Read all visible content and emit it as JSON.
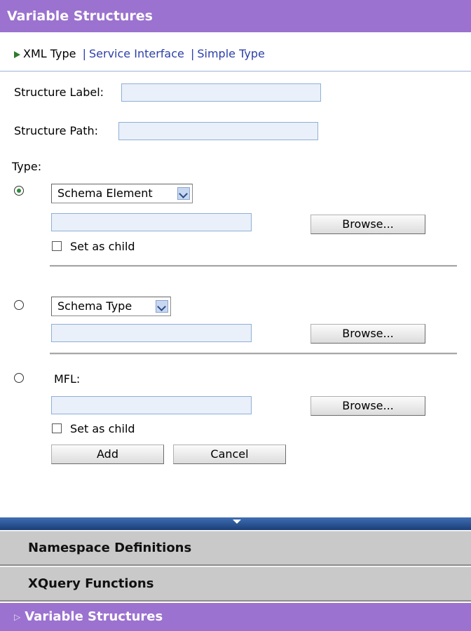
{
  "header": {
    "title": "Variable Structures"
  },
  "tabs": {
    "active": "XML Type",
    "links": [
      "Service Interface",
      "Simple Type"
    ],
    "separator": "|"
  },
  "form": {
    "structure_label": {
      "label": "Structure Label:",
      "value": ""
    },
    "structure_path": {
      "label": "Structure Path:",
      "value": ""
    },
    "type_label": "Type:",
    "options": [
      {
        "selected": true,
        "select_value": "Schema Element",
        "input_value": "",
        "browse_label": "Browse...",
        "checkbox_label": "Set as child"
      },
      {
        "selected": false,
        "select_value": "Schema Type",
        "input_value": "",
        "browse_label": "Browse..."
      },
      {
        "selected": false,
        "label": "MFL:",
        "input_value": "",
        "browse_label": "Browse...",
        "checkbox_label": "Set as child"
      }
    ],
    "add_label": "Add",
    "cancel_label": "Cancel"
  },
  "panels": [
    "Namespace Definitions",
    "XQuery Functions"
  ],
  "footer": {
    "title": "Variable Structures"
  },
  "colors": {
    "header_bg": "#9b72cf",
    "panel_bg": "#c9c9c9",
    "splitter_bg": "#1b3e78",
    "input_bg": "#e9f0fa",
    "link": "#2b3fa8"
  }
}
